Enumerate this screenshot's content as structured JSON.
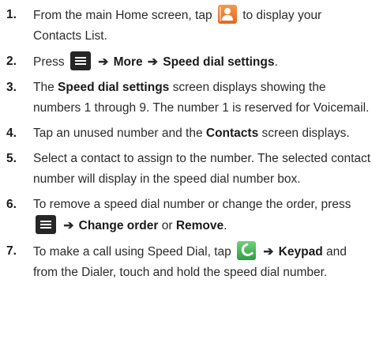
{
  "icons": {
    "contacts": "contacts-icon",
    "menu": "menu-icon",
    "phone": "phone-icon"
  },
  "steps": [
    {
      "number": "1.",
      "t1": "From the main Home screen, tap",
      "t2": "to display your Contacts List."
    },
    {
      "number": "2.",
      "t1": "Press",
      "arrow1": "➔",
      "b1": "More",
      "arrow2": "➔",
      "b2": "Speed dial settings",
      "t2": "."
    },
    {
      "number": "3.",
      "t1": "The",
      "b1": "Speed dial settings",
      "t2": "screen displays showing the numbers 1 through 9. The number 1 is reserved for Voicemail."
    },
    {
      "number": "4.",
      "t1": "Tap an unused number and the",
      "b1": "Contacts",
      "t2": "screen displays."
    },
    {
      "number": "5.",
      "t1": "Select a contact to assign to the number. The selected contact number will display in the speed dial number box."
    },
    {
      "number": "6.",
      "t1": "To remove a speed dial number or change the order, press",
      "arrow1": "➔",
      "b1": "Change order",
      "t2": "or",
      "b2": "Remove",
      "t3": "."
    },
    {
      "number": "7.",
      "t1": "To make a call using Speed Dial, tap",
      "arrow1": "➔",
      "b1": "Keypad",
      "t2": "and from the Dialer, touch and hold the speed dial number."
    }
  ]
}
